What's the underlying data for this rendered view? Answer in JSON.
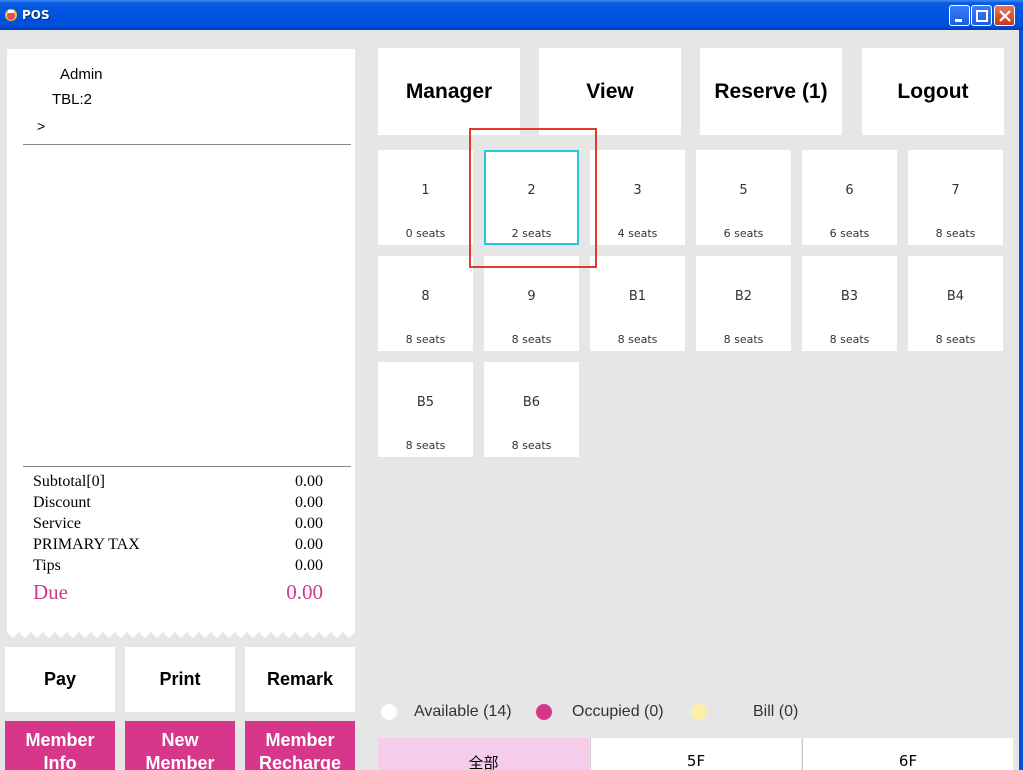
{
  "window": {
    "title": "POS"
  },
  "receipt": {
    "user": "Admin",
    "table": "TBL:2",
    "prompt": ">",
    "totals": [
      {
        "label": "Subtotal[0]",
        "value": "0.00"
      },
      {
        "label": "Discount",
        "value": "0.00"
      },
      {
        "label": "Service",
        "value": "0.00"
      },
      {
        "label": "PRIMARY TAX",
        "value": "0.00"
      },
      {
        "label": "Tips",
        "value": "0.00"
      }
    ],
    "due": {
      "label": "Due",
      "value": "0.00"
    }
  },
  "actions": {
    "pay": "Pay",
    "print": "Print",
    "remark": "Remark"
  },
  "member": {
    "info": [
      "Member",
      "Info"
    ],
    "new": [
      "New",
      "Member"
    ],
    "recharge": [
      "Member",
      "Recharge"
    ]
  },
  "nav": {
    "manager": "Manager",
    "view": "View",
    "reserve": "Reserve (1)",
    "logout": "Logout"
  },
  "tables": [
    {
      "name": "1",
      "seats": "0 seats"
    },
    {
      "name": "2",
      "seats": "2 seats",
      "selected": true
    },
    {
      "name": "3",
      "seats": "4 seats"
    },
    {
      "name": "5",
      "seats": "6 seats"
    },
    {
      "name": "6",
      "seats": "6 seats"
    },
    {
      "name": "7",
      "seats": "8 seats"
    },
    {
      "name": "8",
      "seats": "8 seats"
    },
    {
      "name": "9",
      "seats": "8 seats"
    },
    {
      "name": "B1",
      "seats": "8 seats"
    },
    {
      "name": "B2",
      "seats": "8 seats"
    },
    {
      "name": "B3",
      "seats": "8 seats"
    },
    {
      "name": "B4",
      "seats": "8 seats"
    },
    {
      "name": "B5",
      "seats": "8 seats"
    },
    {
      "name": "B6",
      "seats": "8 seats"
    }
  ],
  "legend": {
    "available": "Available (14)",
    "occupied": "Occupied (0)",
    "bill": "Bill (0)"
  },
  "floors": [
    "全部",
    "5F",
    "6F"
  ],
  "colors": {
    "accent": "#d6378b",
    "due": "#cf3b8c",
    "selected_border": "#22c8d8",
    "highlight": "#e03a2e",
    "floor_active": "#f5cdea",
    "bill_dot": "#fbf0a6"
  }
}
